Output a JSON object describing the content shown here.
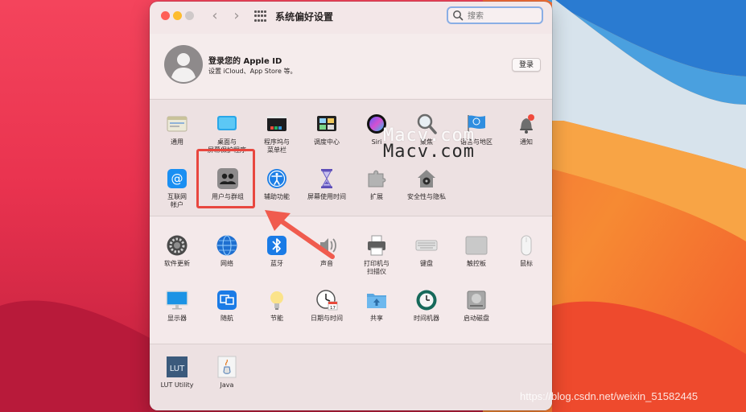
{
  "window": {
    "title": "系统偏好设置"
  },
  "search": {
    "placeholder": "搜索"
  },
  "account": {
    "title": "登录您的 Apple ID",
    "subtitle": "设置 iCloud、App Store 等。",
    "login_label": "登录"
  },
  "panes": {
    "general": "通用",
    "desktop": "桌面与",
    "desktop_l2": "屏幕保护程序",
    "dock": "程序坞与",
    "dock_l2": "菜单栏",
    "mission": "调度中心",
    "siri": "Siri",
    "spotlight": "聚焦",
    "language": "语言与地区",
    "notifications": "通知",
    "internet": "互联网",
    "internet_l2": "帐户",
    "users": "用户与群组",
    "accessibility": "辅助功能",
    "screentime": "屏幕使用时间",
    "extensions": "扩展",
    "security": "安全性与隐私",
    "update": "软件更新",
    "network": "网络",
    "bluetooth": "蓝牙",
    "sound": "声音",
    "printers": "打印机与",
    "printers_l2": "扫描仪",
    "keyboard": "键盘",
    "trackpad": "触控板",
    "mouse": "鼠标",
    "displays": "显示器",
    "sidecar": "随航",
    "battery": "节能",
    "datetime": "日期与时间",
    "sharing": "共享",
    "timemachine": "时间机器",
    "startup": "启动磁盘",
    "lut": "LUT Utility",
    "java": "Java"
  },
  "icons": {
    "lut_text": "LUT",
    "calendar_day": "17"
  },
  "watermark": "Macv.com",
  "credit": "https://blog.csdn.net/weixin_51582445",
  "colors": {
    "highlight": "#e8473f",
    "search_focus": "#8aaee5",
    "window_bg": "#f3e7e8"
  }
}
